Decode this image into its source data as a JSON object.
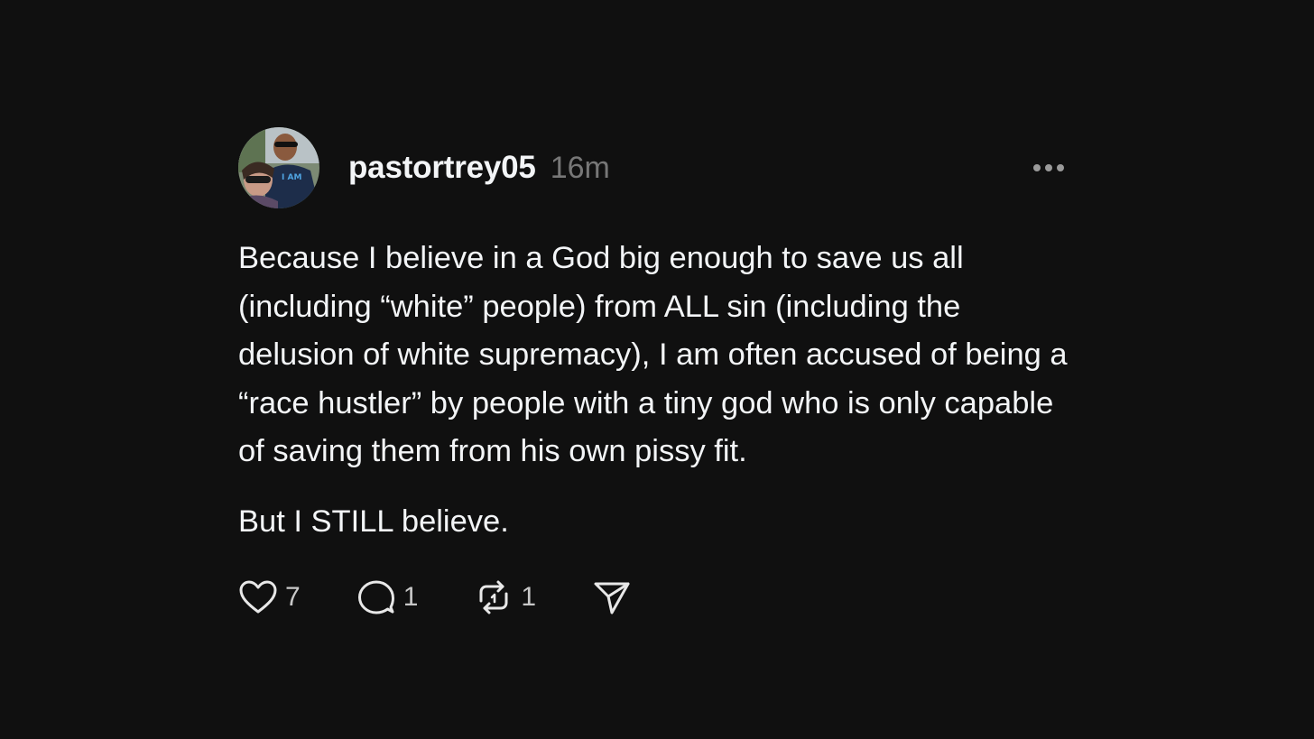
{
  "post": {
    "author": {
      "username": "pastortrey05",
      "timestamp": "16m"
    },
    "paragraphs": [
      "Because I believe in a God big enough to save us all (including “white” people) from ALL sin (including the delusion of white supremacy), I am often accused of being a “race hustler” by people with a tiny god who is only capable of saving them from his own pissy fit.",
      "But I STILL believe."
    ],
    "actions": {
      "likes": "7",
      "replies": "1",
      "reposts": "1"
    },
    "icons": {
      "like": "heart-icon",
      "reply": "speech-bubble-icon",
      "repost": "repost-icon",
      "share": "paper-plane-icon",
      "more": "ellipsis-icon"
    }
  },
  "colors": {
    "background": "#101010",
    "text": "#f3f5f7",
    "muted": "#777777"
  }
}
